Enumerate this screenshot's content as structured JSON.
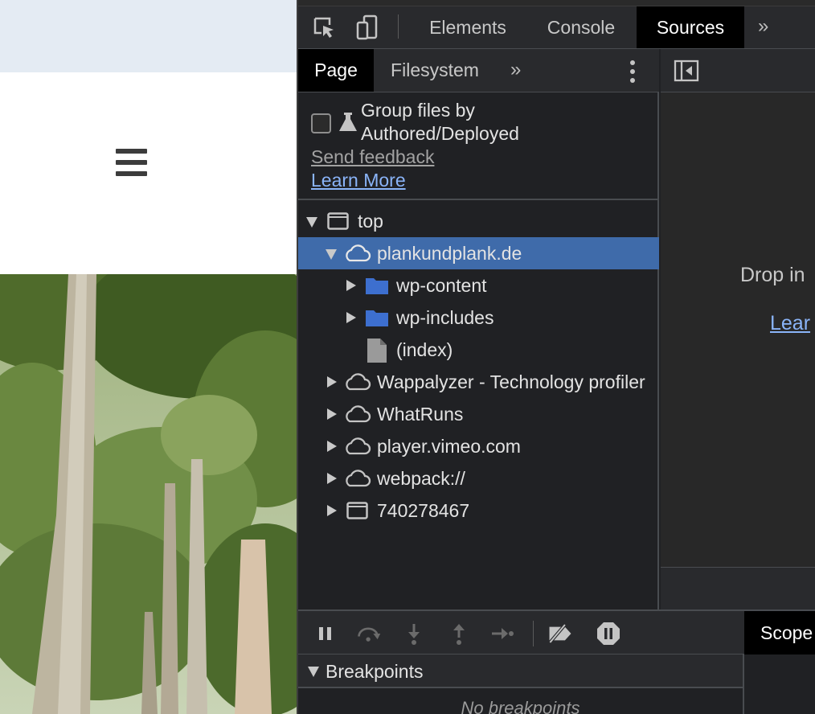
{
  "devtools": {
    "tabs": [
      {
        "label": "Elements"
      },
      {
        "label": "Console"
      },
      {
        "label": "Sources"
      }
    ],
    "more_tabs": "»"
  },
  "navigator": {
    "tabs": [
      {
        "label": "Page"
      },
      {
        "label": "Filesystem"
      }
    ],
    "more_tabs": "»",
    "group_files": {
      "line1": "Group files by",
      "line2": "Authored/Deployed",
      "checked": false
    },
    "send_feedback": "Send feedback",
    "learn_more": "Learn More",
    "tree": [
      {
        "label": "top"
      },
      {
        "label": "plankundplank.de"
      },
      {
        "label": "wp-content"
      },
      {
        "label": "wp-includes"
      },
      {
        "label": "(index)"
      },
      {
        "label": "Wappalyzer - Technology profiler"
      },
      {
        "label": "WhatRuns"
      },
      {
        "label": "player.vimeo.com"
      },
      {
        "label": "webpack://"
      },
      {
        "label": "740278467"
      }
    ]
  },
  "editor": {
    "drop_text": "Drop in",
    "learn_link": "Lear"
  },
  "debugger": {
    "scope_tab": "Scope",
    "breakpoints_label": "Breakpoints",
    "breakpoints_empty": "No breakpoints"
  },
  "colors": {
    "selected_row": "#3f6baa",
    "link": "#8ab4f8",
    "folder": "#3d6fcf",
    "webpage_topbar": "#e4ebf3"
  },
  "icons": [
    "inspect-element-icon",
    "device-toolbar-icon",
    "frame-icon",
    "cloud-icon",
    "folder-icon",
    "file-icon",
    "flask-icon",
    "toggle-sidebar-icon",
    "pause-icon",
    "step-over-icon",
    "step-into-icon",
    "step-out-icon",
    "step-icon",
    "deactivate-breakpoints-icon",
    "pause-on-exceptions-icon",
    "hamburger-menu-icon"
  ]
}
